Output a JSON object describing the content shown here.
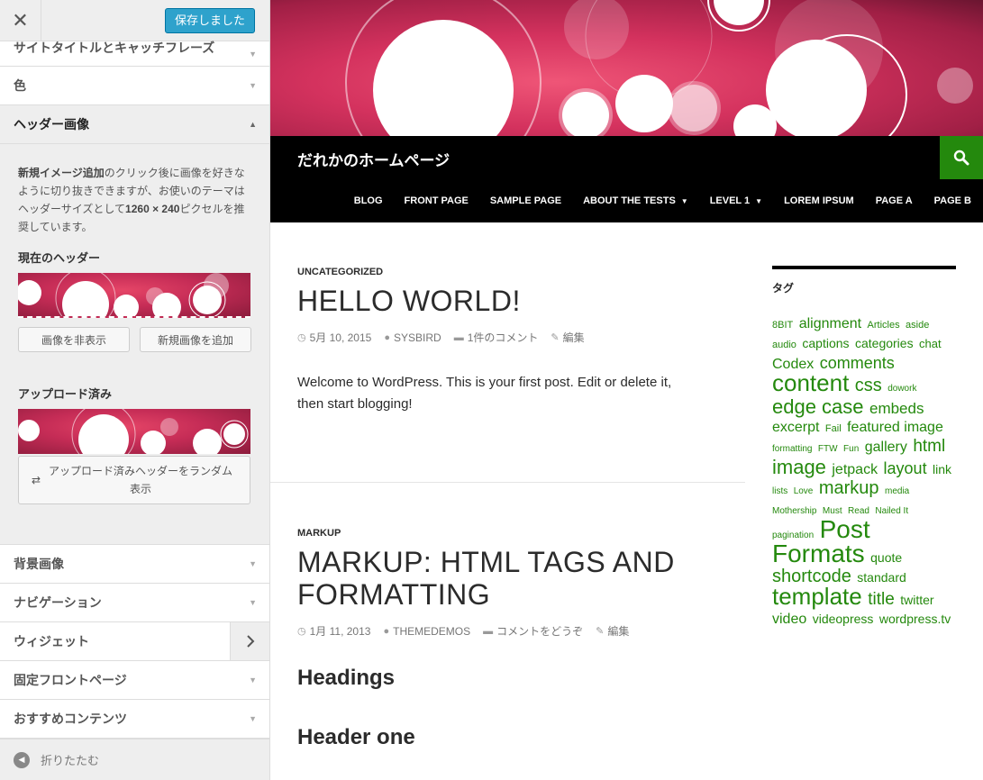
{
  "sidebar": {
    "save_label": "保存しました",
    "close_glyph": "✕",
    "sections_top": [
      {
        "label": "サイトタイトルとキャッチフレーズ"
      },
      {
        "label": "色"
      },
      {
        "label": "ヘッダー画像"
      }
    ],
    "header_panel": {
      "desc_bold1": "新規イメージ追加",
      "desc_part1": "のクリック後に画像を好きなように切り抜きできますが、お使いのテーマはヘッダーサイズとして",
      "desc_bold2": "1260 × 240",
      "desc_part2": "ピクセルを推奨しています。",
      "current_label": "現在のヘッダー",
      "hide_btn": "画像を非表示",
      "new_btn": "新規画像を追加",
      "uploaded_label": "アップロード済み",
      "random_btn": "アップロード済みヘッダーをランダム表示"
    },
    "sections_bottom": [
      {
        "label": "背景画像"
      },
      {
        "label": "ナビゲーション"
      },
      {
        "label": "ウィジェット"
      },
      {
        "label": "固定フロントページ"
      },
      {
        "label": "おすすめコンテンツ"
      }
    ],
    "collapse_label": "折りたたむ"
  },
  "site": {
    "title": "だれかのホームページ",
    "nav": [
      "BLOG",
      "FRONT PAGE",
      "SAMPLE PAGE",
      "ABOUT THE TESTS",
      "LEVEL 1",
      "LOREM IPSUM",
      "PAGE A",
      "PAGE B"
    ],
    "posts": [
      {
        "category": "UNCATEGORIZED",
        "title": "HELLO WORLD!",
        "date": "5月 10, 2015",
        "author": "SYSBIRD",
        "comments": "1件のコメント",
        "edit": "編集",
        "body_line1": "Welcome to WordPress. This is your first post. Edit or delete it,",
        "body_line2": "then start blogging!"
      },
      {
        "category": "MARKUP",
        "title_line1": "MARKUP: HTML TAGS AND",
        "title_line2": "FORMATTING",
        "date": "1月 11, 2013",
        "author": "THEMEDEMOS",
        "comments": "コメントをどうぞ",
        "edit": "編集",
        "heading1": "Headings",
        "heading2": "Header one"
      }
    ],
    "widget_title": "タグ",
    "tags": [
      {
        "t": "8BIT",
        "s": 11
      },
      {
        "t": "alignment",
        "s": 16
      },
      {
        "t": "Articles",
        "s": 11
      },
      {
        "t": "aside",
        "s": 11
      },
      {
        "t": "audio",
        "s": 11
      },
      {
        "t": "captions",
        "s": 14
      },
      {
        "t": "categories",
        "s": 14
      },
      {
        "t": "chat",
        "s": 13
      },
      {
        "t": "Codex",
        "s": 16
      },
      {
        "t": "comments",
        "s": 18
      },
      {
        "t": "content",
        "s": 26
      },
      {
        "t": "css",
        "s": 20
      },
      {
        "t": "dowork",
        "s": 10
      },
      {
        "t": "edge case",
        "s": 22
      },
      {
        "t": "embeds",
        "s": 17
      },
      {
        "t": "excerpt",
        "s": 16
      },
      {
        "t": "Fail",
        "s": 11
      },
      {
        "t": "featured image",
        "s": 16
      },
      {
        "t": "formatting",
        "s": 10
      },
      {
        "t": "FTW",
        "s": 10
      },
      {
        "t": "Fun",
        "s": 10
      },
      {
        "t": "gallery",
        "s": 16
      },
      {
        "t": "html",
        "s": 19
      },
      {
        "t": "image",
        "s": 22
      },
      {
        "t": "jetpack",
        "s": 16
      },
      {
        "t": "layout",
        "s": 18
      },
      {
        "t": "link",
        "s": 14
      },
      {
        "t": "lists",
        "s": 10
      },
      {
        "t": "Love",
        "s": 10
      },
      {
        "t": "markup",
        "s": 20
      },
      {
        "t": "media",
        "s": 10
      },
      {
        "t": "Mothership",
        "s": 10
      },
      {
        "t": "Must",
        "s": 10
      },
      {
        "t": "Read",
        "s": 10
      },
      {
        "t": "Nailed It",
        "s": 10
      },
      {
        "t": "pagination",
        "s": 10
      },
      {
        "t": "Post",
        "s": 28
      },
      {
        "t": "Formats",
        "s": 28
      },
      {
        "t": "quote",
        "s": 14
      },
      {
        "t": "shortcode",
        "s": 20
      },
      {
        "t": "standard",
        "s": 14
      },
      {
        "t": "template",
        "s": 26
      },
      {
        "t": "title",
        "s": 19
      },
      {
        "t": "twitter",
        "s": 14
      },
      {
        "t": "video",
        "s": 16
      },
      {
        "t": "videopress",
        "s": 14
      },
      {
        "t": "wordpress.tv",
        "s": 14
      }
    ]
  },
  "colors": {
    "accent_green": "#24890d",
    "save_blue": "#2ea2cc",
    "banner_pink": "#d4325e"
  }
}
